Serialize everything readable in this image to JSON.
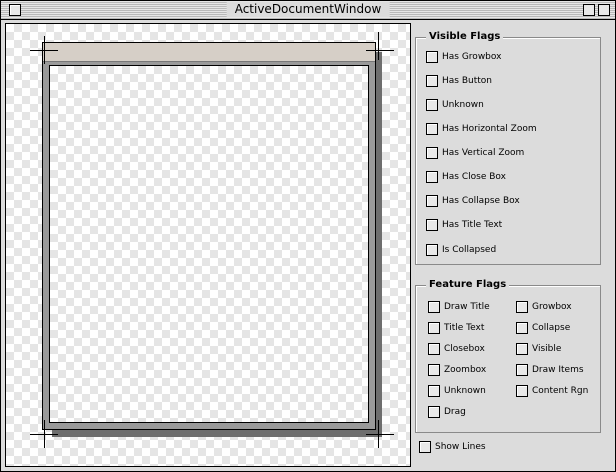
{
  "window": {
    "title": "ActiveDocumentWindow"
  },
  "visible_flags": {
    "title": "Visible Flags",
    "items": [
      "Has Growbox",
      "Has Button",
      "Unknown",
      "Has Horizontal Zoom",
      "Has Vertical Zoom",
      "Has Close Box",
      "Has Collapse Box",
      "Has Title Text",
      "Is Collapsed"
    ]
  },
  "feature_flags": {
    "title": "Feature Flags",
    "left": [
      "Draw Title",
      "Title Text",
      "Closebox",
      "Zoombox",
      "Unknown",
      "Drag"
    ],
    "right": [
      "Growbox",
      "Collapse",
      "Visible",
      "Draw Items",
      "Content Rgn"
    ]
  },
  "show_lines": {
    "label": "Show Lines"
  }
}
